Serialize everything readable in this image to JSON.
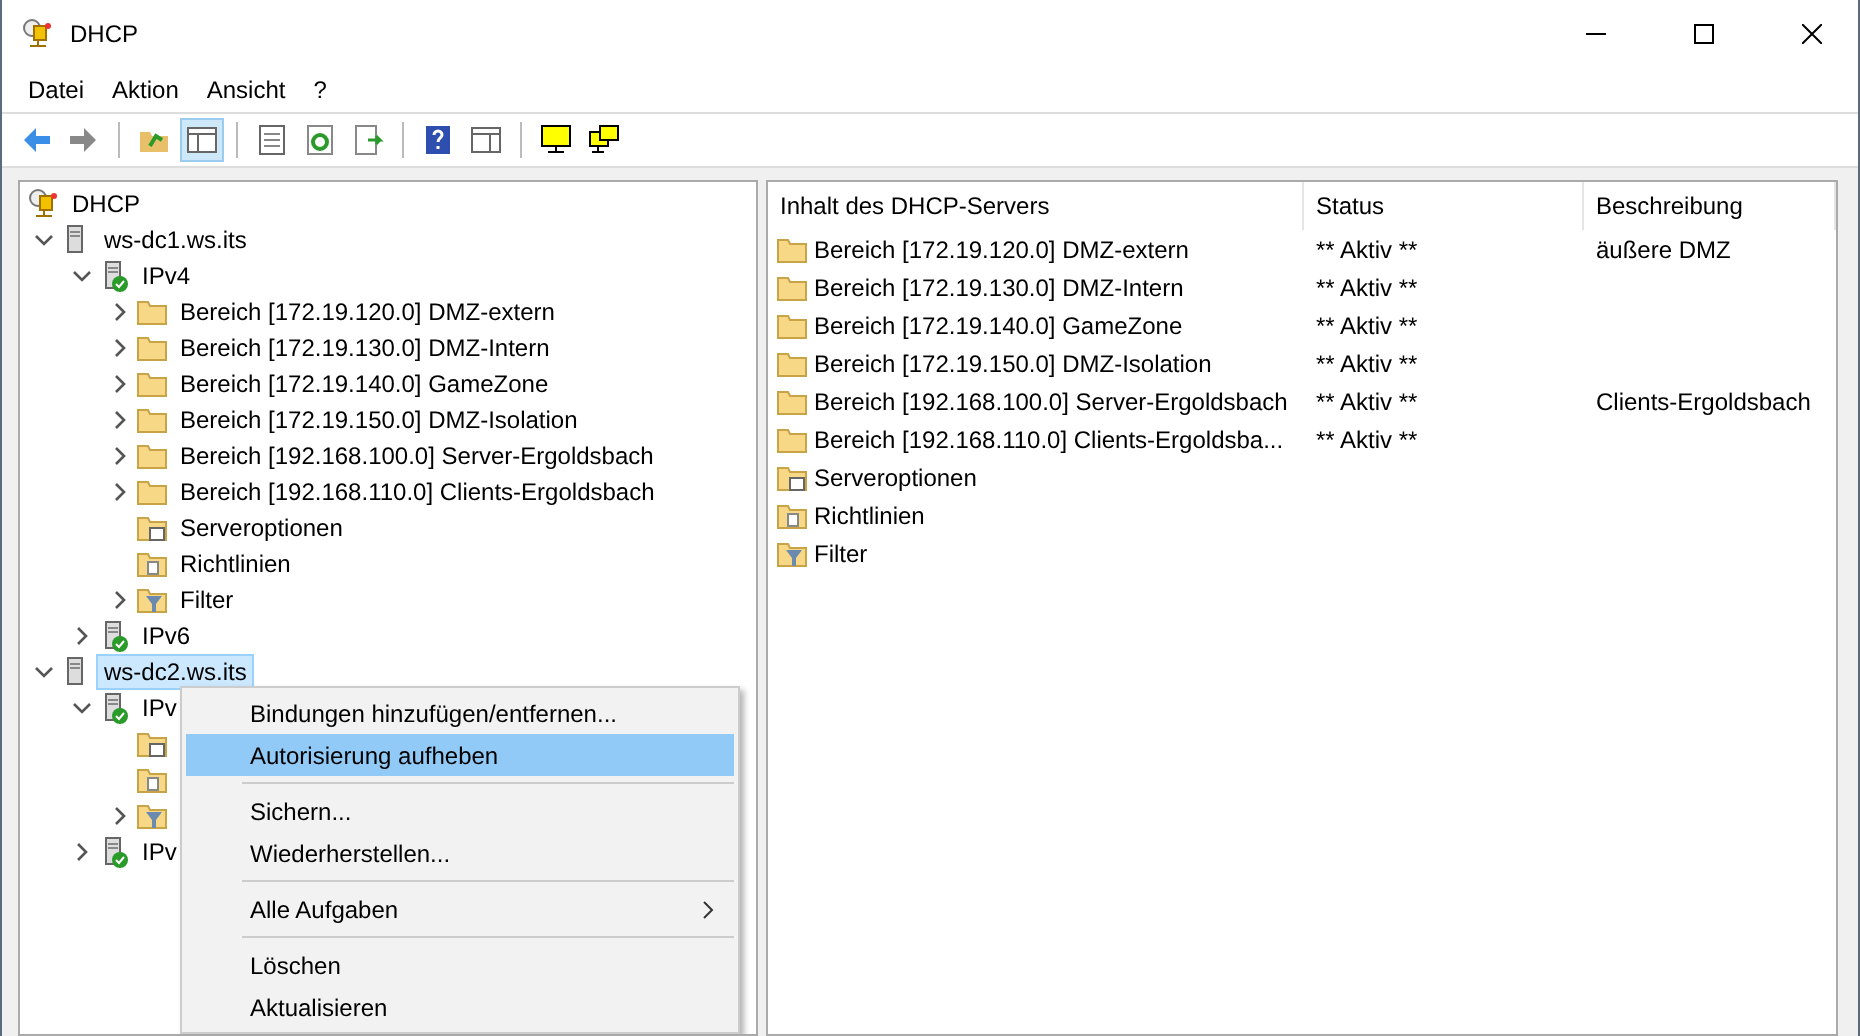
{
  "window": {
    "title": "DHCP"
  },
  "menubar": [
    "Datei",
    "Aktion",
    "Ansicht",
    "?"
  ],
  "toolbar": [
    {
      "kind": "back"
    },
    {
      "kind": "forward"
    },
    {
      "kind": "sep"
    },
    {
      "kind": "up"
    },
    {
      "kind": "pane",
      "selected": true
    },
    {
      "kind": "sep"
    },
    {
      "kind": "doc"
    },
    {
      "kind": "refresh"
    },
    {
      "kind": "export"
    },
    {
      "kind": "sep"
    },
    {
      "kind": "help"
    },
    {
      "kind": "pane2"
    },
    {
      "kind": "sep"
    },
    {
      "kind": "monitor"
    },
    {
      "kind": "monitors"
    }
  ],
  "tree": [
    {
      "kind": "root",
      "label": "DHCP",
      "children": [
        {
          "kind": "server",
          "label": "ws-dc1.ws.its",
          "expanded": true,
          "selected": false,
          "children": [
            {
              "kind": "ipv",
              "label": "IPv4",
              "expanded": true,
              "selected": false,
              "children": [
                {
                  "kind": "folder",
                  "label": "Bereich [172.19.120.0] DMZ-extern",
                  "expanded": false,
                  "selected": false
                },
                {
                  "kind": "folder",
                  "label": "Bereich [172.19.130.0] DMZ-Intern",
                  "expanded": false,
                  "selected": false
                },
                {
                  "kind": "folder",
                  "label": "Bereich [172.19.140.0] GameZone",
                  "expanded": false,
                  "selected": false
                },
                {
                  "kind": "folder",
                  "label": "Bereich [172.19.150.0] DMZ-Isolation",
                  "expanded": false,
                  "selected": false
                },
                {
                  "kind": "folder",
                  "label": "Bereich [192.168.100.0] Server-Ergoldsbach",
                  "expanded": false,
                  "selected": false
                },
                {
                  "kind": "folder",
                  "label": "Bereich [192.168.110.0] Clients-Ergoldsbach",
                  "expanded": false,
                  "selected": false
                },
                {
                  "kind": "options",
                  "label": "Serveroptionen",
                  "selected": false
                },
                {
                  "kind": "policies",
                  "label": "Richtlinien",
                  "selected": false
                },
                {
                  "kind": "filter",
                  "label": "Filter",
                  "expanded": false,
                  "selected": false
                }
              ]
            },
            {
              "kind": "ipv",
              "label": "IPv6",
              "expanded": false,
              "selected": false
            }
          ]
        },
        {
          "kind": "server",
          "label": "ws-dc2.ws.its",
          "expanded": true,
          "selected": true,
          "children": [
            {
              "kind": "ipv",
              "label": "IPv",
              "expanded": true,
              "selected": false,
              "children": [
                {
                  "kind": "options"
                },
                {
                  "kind": "policies"
                },
                {
                  "kind": "filter",
                  "expanded": false
                }
              ]
            },
            {
              "kind": "ipv",
              "label": "IPv",
              "expanded": false,
              "selected": false
            }
          ]
        }
      ]
    }
  ],
  "list": {
    "columns": [
      "Inhalt des DHCP-Servers",
      "Status",
      "Beschreibung"
    ],
    "rows": [
      {
        "kind": "folder",
        "cells": [
          "Bereich [172.19.120.0] DMZ-extern",
          "** Aktiv **",
          "äußere DMZ"
        ]
      },
      {
        "kind": "folder",
        "cells": [
          "Bereich [172.19.130.0] DMZ-Intern",
          "** Aktiv **",
          ""
        ]
      },
      {
        "kind": "folder",
        "cells": [
          "Bereich [172.19.140.0] GameZone",
          "** Aktiv **",
          ""
        ]
      },
      {
        "kind": "folder",
        "cells": [
          "Bereich [172.19.150.0] DMZ-Isolation",
          "** Aktiv **",
          ""
        ]
      },
      {
        "kind": "folder",
        "cells": [
          "Bereich [192.168.100.0] Server-Ergoldsbach",
          "** Aktiv **",
          "Clients-Ergoldsbach"
        ]
      },
      {
        "kind": "folder",
        "cells": [
          "Bereich [192.168.110.0] Clients-Ergoldsba...",
          "** Aktiv **",
          ""
        ]
      },
      {
        "kind": "options",
        "cells": [
          "Serveroptionen",
          "",
          ""
        ]
      },
      {
        "kind": "policies",
        "cells": [
          "Richtlinien",
          "",
          ""
        ]
      },
      {
        "kind": "filter",
        "cells": [
          "Filter",
          "",
          ""
        ]
      }
    ]
  },
  "context_menu": {
    "groups": [
      [
        {
          "label": "Bindungen hinzufügen/entfernen...",
          "selected": false
        },
        {
          "label": "Autorisierung aufheben",
          "selected": true
        }
      ],
      [
        {
          "label": "Sichern...",
          "selected": false
        },
        {
          "label": "Wiederherstellen...",
          "selected": false
        }
      ],
      [
        {
          "label": "Alle Aufgaben",
          "selected": false,
          "submenu": true
        }
      ],
      [
        {
          "label": "Löschen",
          "selected": false
        },
        {
          "label": "Aktualisieren",
          "selected": false
        }
      ]
    ]
  }
}
